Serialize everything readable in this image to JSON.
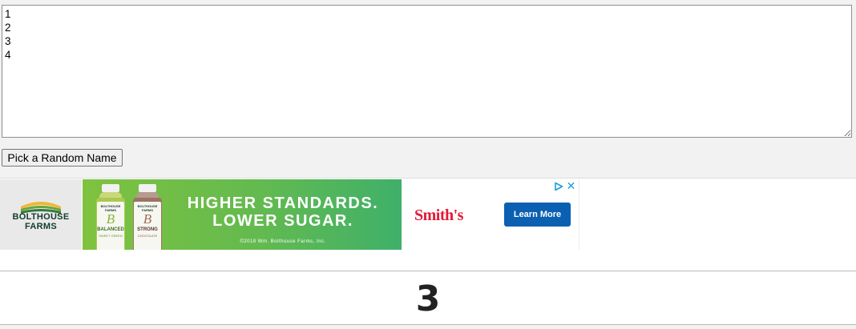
{
  "names_input": {
    "value": "1\n2\n3\n4"
  },
  "pick_button": {
    "label": "Pick a Random Name"
  },
  "ad": {
    "brand_line_1": "BOLTHOUSE",
    "brand_line_2": "FARMS",
    "headline_line_1": "HIGHER STANDARDS.",
    "headline_line_2": "LOWER SUGAR.",
    "copyright": "©2018 Wm. Bolthouse Farms, Inc.",
    "store": "Smith's",
    "cta_label": "Learn More",
    "close_glyph": "✕",
    "bottles": [
      {
        "brand": "BOLTHOUSE FARMS",
        "letter": "B",
        "name": "BALANCED",
        "sub": "SWEET GREEN"
      },
      {
        "brand": "BOLTHOUSE FARMS",
        "letter": "B",
        "name": "STRONG",
        "sub": "CHOCOLATE"
      }
    ],
    "colors": {
      "brand_dark": "#123d2b",
      "green_start": "#7fc23f",
      "green_end": "#3fb06a",
      "store_red": "#e31937",
      "cta_blue": "#0b60b1",
      "adchoices": "#1a9fd9"
    }
  },
  "result": {
    "name": "3"
  }
}
